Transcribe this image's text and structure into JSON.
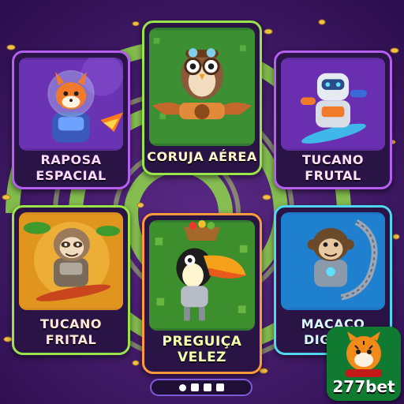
{
  "cards": [
    {
      "title_line1": "RAPOSA",
      "title_line2": "ESPACIAL",
      "character_icon": "fox-astronaut-icon",
      "label_color": "#ffd9ff"
    },
    {
      "title_line1": "CORUJA AÉREA",
      "title_line2": "",
      "character_icon": "owl-pilot-icon",
      "label_color": "#fff6c8"
    },
    {
      "title_line1": "TUCANO",
      "title_line2": "FRUTAL",
      "character_icon": "robot-skater-icon",
      "label_color": "#ffe0f4"
    },
    {
      "title_line1": "TUCANO",
      "title_line2": "FRITAL",
      "character_icon": "sloth-skater-icon",
      "label_color": "#ffe9d6"
    },
    {
      "title_line1": "PREGUIÇA",
      "title_line2": "VELEZ",
      "character_icon": "toucan-robot-icon",
      "label_color": "#f5ffb0"
    },
    {
      "title_line1": "MACACO",
      "title_line2": "DIGITAL",
      "character_icon": "monkey-cyborg-icon",
      "label_color": "#d9f7ff"
    }
  ],
  "logo": {
    "text": "277bet",
    "icon": "tiger-mascot-icon"
  },
  "pager": {
    "dots": 1,
    "squares": 3
  }
}
